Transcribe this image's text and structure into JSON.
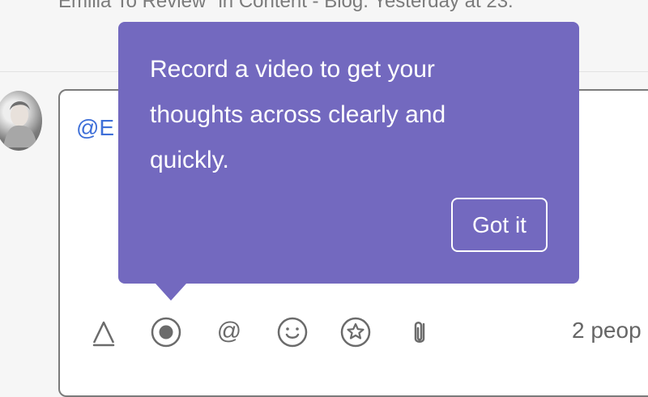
{
  "activity": {
    "text": "Emilia To Review\" in Content - Blog.  Yesterday at 23:"
  },
  "composer": {
    "mention": "@E"
  },
  "tooltip": {
    "message": "Record a video to get your thoughts across clearly and quickly.",
    "button_label": "Got it"
  },
  "toolbar": {
    "icons": [
      "text-format-icon",
      "record-icon",
      "mention-icon",
      "emoji-icon",
      "star-icon",
      "attachment-icon"
    ],
    "people_count": "2 peop"
  }
}
